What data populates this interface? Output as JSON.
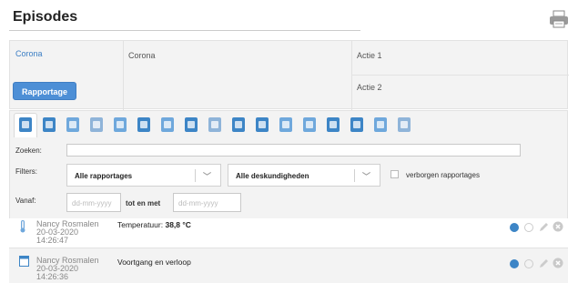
{
  "header": {
    "title": "Episodes",
    "print_icon": "printer-icon"
  },
  "episode": {
    "link": "Corona",
    "name": "Corona",
    "actions": [
      "Actie 1",
      "Actie 2"
    ],
    "rapportage_button": "Rapportage"
  },
  "tabs": [
    {
      "icon": "report-icon",
      "color": "#3d85c6",
      "active": true
    },
    {
      "icon": "calendar-icon",
      "color": "#3d85c6"
    },
    {
      "icon": "briefcase-icon",
      "color": "#6fa8dc"
    },
    {
      "icon": "heart-icon",
      "color": "#8fb4d9"
    },
    {
      "icon": "thermometer-icon",
      "color": "#6fa8dc"
    },
    {
      "icon": "scale-icon",
      "color": "#3d85c6"
    },
    {
      "icon": "bottle-icon",
      "color": "#6fa8dc"
    },
    {
      "icon": "bandage-icon",
      "color": "#3d85c6"
    },
    {
      "icon": "layers-icon",
      "color": "#8fb4d9"
    },
    {
      "icon": "medical-cross-icon",
      "color": "#3d85c6"
    },
    {
      "icon": "stethoscope-icon",
      "color": "#3d85c6"
    },
    {
      "icon": "checklist-icon",
      "color": "#6fa8dc"
    },
    {
      "icon": "face-icon",
      "color": "#6fa8dc"
    },
    {
      "icon": "document-icon",
      "color": "#3d85c6"
    },
    {
      "icon": "id-card-icon",
      "color": "#3d85c6"
    },
    {
      "icon": "notes-icon",
      "color": "#6fa8dc"
    },
    {
      "icon": "group-icon",
      "color": "#8fb4d9"
    }
  ],
  "filters": {
    "search_label": "Zoeken:",
    "filters_label": "Filters:",
    "select_reports": "Alle rapportages",
    "select_expertise": "Alle deskundigheden",
    "hidden_label": "verborgen rapportages",
    "from_label": "Vanaf:",
    "date_placeholder": "dd-mm-yyyy",
    "until_label": "tot en met"
  },
  "reports": [
    {
      "icon": "thermometer-icon",
      "author": "Nancy Rosmalen",
      "date": "20-03-2020",
      "time": "14:26:47",
      "desc_label": "Temperatuur:",
      "desc_value": "38,8 °C"
    },
    {
      "icon": "notebook-icon",
      "author": "Nancy Rosmalen",
      "date": "20-03-2020",
      "time": "14:26:36",
      "desc_label": "Voortgang en verloop",
      "desc_value": ""
    }
  ]
}
